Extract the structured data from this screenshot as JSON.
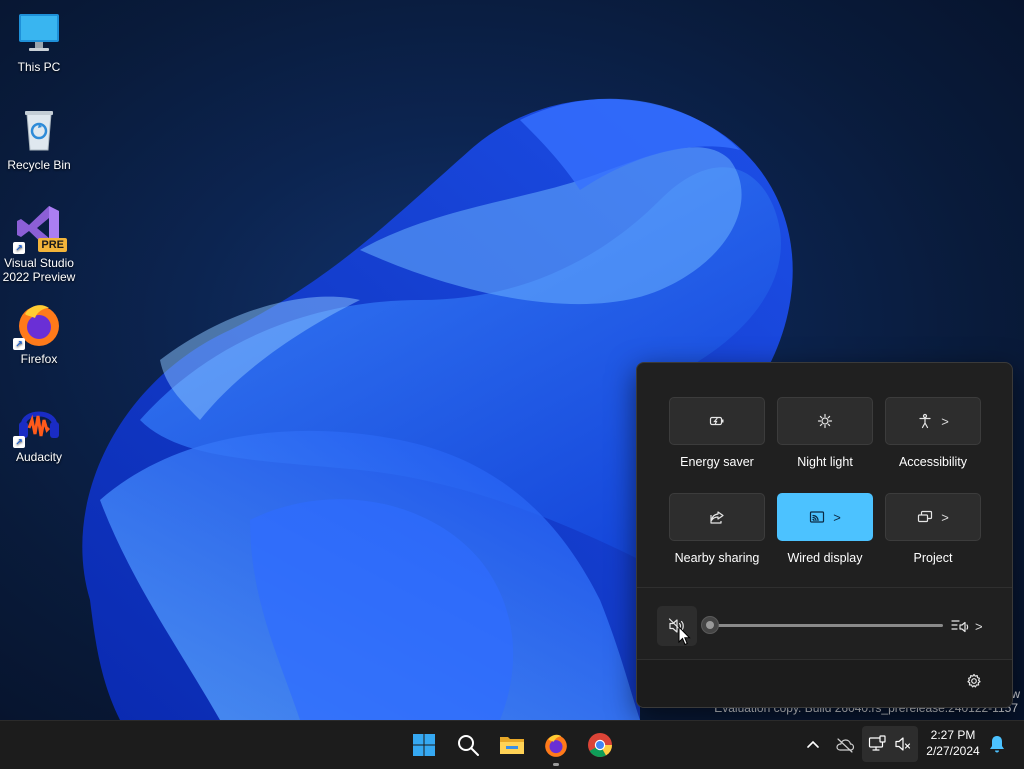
{
  "desktop": {
    "icons": [
      {
        "label": "This PC",
        "icon": "monitor-icon"
      },
      {
        "label": "Recycle Bin",
        "icon": "recycle-bin-icon"
      },
      {
        "label": "Visual Studio 2022 Preview",
        "icon": "visual-studio-icon",
        "badge": "PRE"
      },
      {
        "label": "Firefox",
        "icon": "firefox-icon"
      },
      {
        "label": "Audacity",
        "icon": "audacity-icon"
      }
    ],
    "watermark": "Evaluation copy. Build 26040.rs_prerelease.240122-1157",
    "watermark_edge": "w"
  },
  "quick_settings": {
    "tiles": [
      {
        "label": "Energy saver",
        "icon": "energy-saver-icon",
        "active": false,
        "expand": false
      },
      {
        "label": "Night light",
        "icon": "night-light-icon",
        "active": false,
        "expand": false
      },
      {
        "label": "Accessibility",
        "icon": "accessibility-icon",
        "active": false,
        "expand": true
      },
      {
        "label": "Nearby sharing",
        "icon": "share-icon",
        "active": false,
        "expand": false
      },
      {
        "label": "Wired display",
        "icon": "cast-icon",
        "active": true,
        "expand": true
      },
      {
        "label": "Project",
        "icon": "project-icon",
        "active": false,
        "expand": true
      }
    ],
    "volume": {
      "level": 0,
      "muted": true
    },
    "chevron": ">"
  },
  "taskbar": {
    "apps": [
      "start-icon",
      "search-icon",
      "file-explorer-icon",
      "firefox-icon",
      "chrome-icon"
    ],
    "tray": {
      "chevron": "^"
    },
    "clock": {
      "time": "2:27 PM",
      "date": "2/27/2024"
    }
  },
  "colors": {
    "accent": "#4cc2ff",
    "panel": "#202020",
    "taskbar": "#1c1c1c"
  }
}
